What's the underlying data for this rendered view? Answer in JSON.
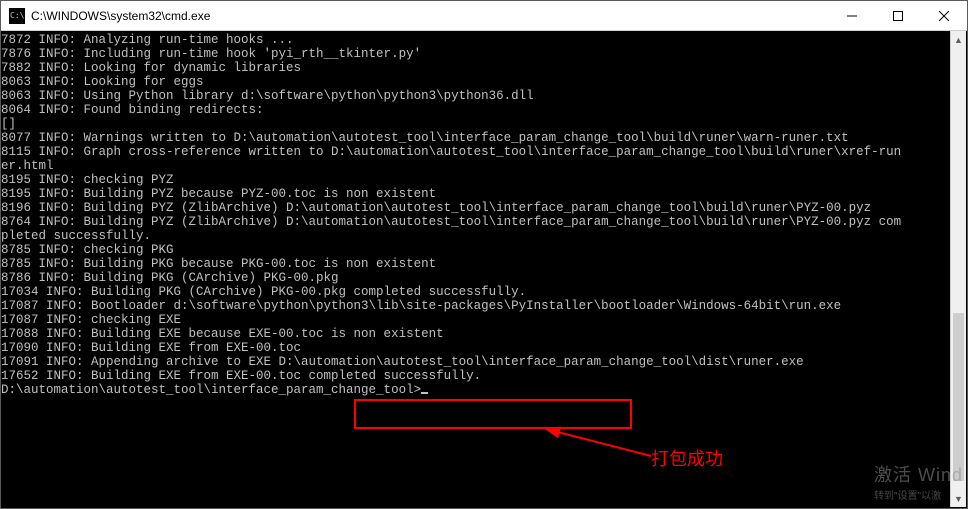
{
  "window": {
    "title": "C:\\WINDOWS\\system32\\cmd.exe"
  },
  "terminal": {
    "lines": [
      "7872 INFO: Analyzing run-time hooks ...",
      "7876 INFO: Including run-time hook 'pyi_rth__tkinter.py'",
      "7882 INFO: Looking for dynamic libraries",
      "8063 INFO: Looking for eggs",
      "8063 INFO: Using Python library d:\\software\\python\\python3\\python36.dll",
      "8064 INFO: Found binding redirects:",
      "[]",
      "8077 INFO: Warnings written to D:\\automation\\autotest_tool\\interface_param_change_tool\\build\\runer\\warn-runer.txt",
      "8115 INFO: Graph cross-reference written to D:\\automation\\autotest_tool\\interface_param_change_tool\\build\\runer\\xref-run",
      "er.html",
      "8195 INFO: checking PYZ",
      "8195 INFO: Building PYZ because PYZ-00.toc is non existent",
      "8196 INFO: Building PYZ (ZlibArchive) D:\\automation\\autotest_tool\\interface_param_change_tool\\build\\runer\\PYZ-00.pyz",
      "8764 INFO: Building PYZ (ZlibArchive) D:\\automation\\autotest_tool\\interface_param_change_tool\\build\\runer\\PYZ-00.pyz com",
      "pleted successfully.",
      "8785 INFO: checking PKG",
      "8785 INFO: Building PKG because PKG-00.toc is non existent",
      "8786 INFO: Building PKG (CArchive) PKG-00.pkg",
      "17034 INFO: Building PKG (CArchive) PKG-00.pkg completed successfully.",
      "17087 INFO: Bootloader d:\\software\\python\\python3\\lib\\site-packages\\PyInstaller\\bootloader\\Windows-64bit\\run.exe",
      "17087 INFO: checking EXE",
      "17088 INFO: Building EXE because EXE-00.toc is non existent",
      "17090 INFO: Building EXE from EXE-00.toc",
      "17091 INFO: Appending archive to EXE D:\\automation\\autotest_tool\\interface_param_change_tool\\dist\\runer.exe",
      "17652 INFO: Building EXE from EXE-00.toc completed successfully.",
      "",
      "D:\\automation\\autotest_tool\\interface_param_change_tool>"
    ],
    "prompt_has_cursor": true
  },
  "annotation": {
    "label": "打包成功"
  },
  "watermark": {
    "line1": "激活 Wind",
    "line2": "转到\"设置\"以激"
  }
}
